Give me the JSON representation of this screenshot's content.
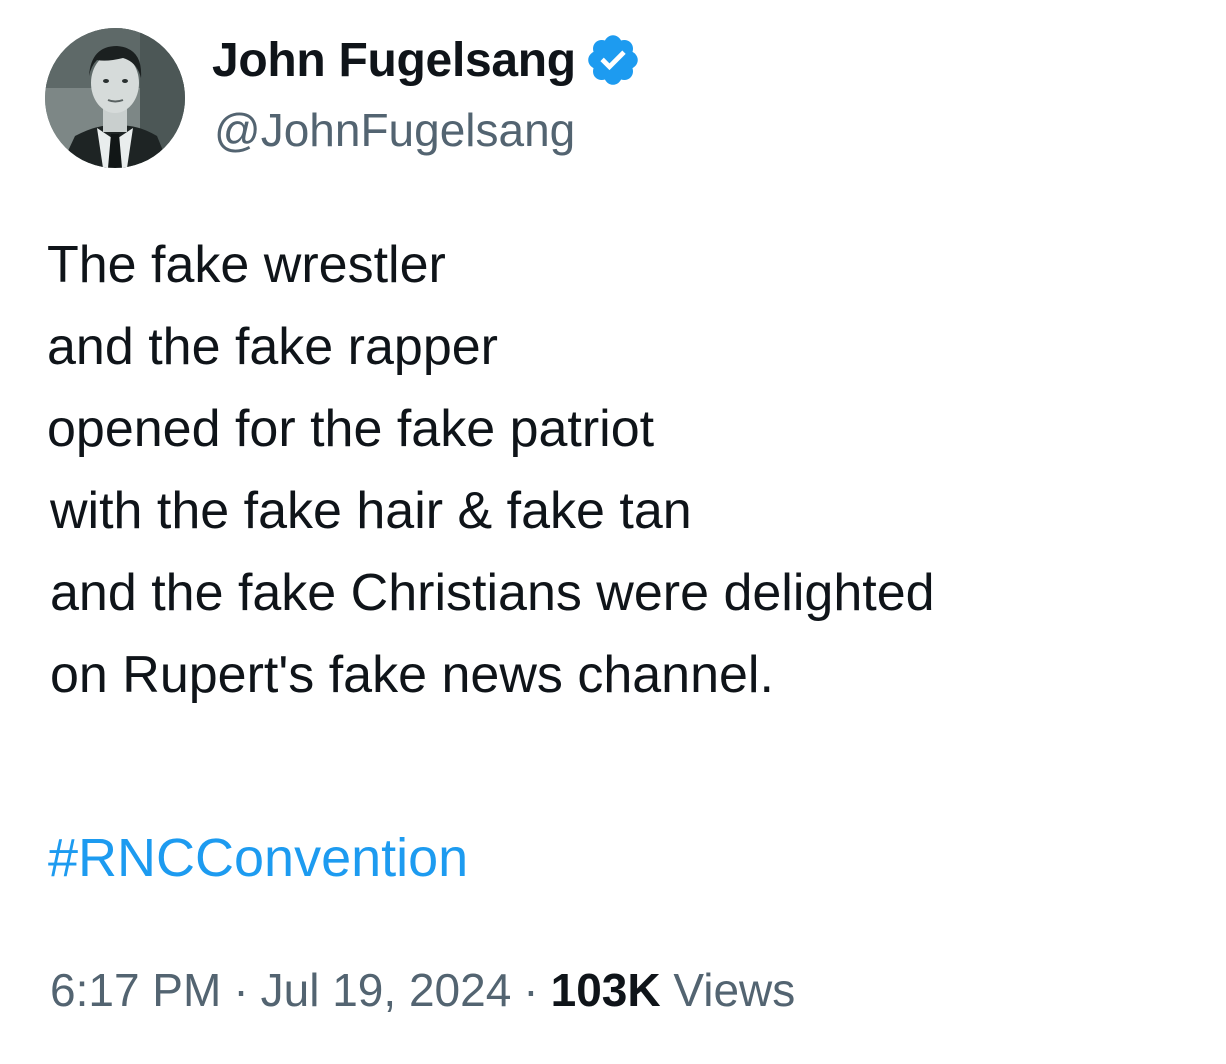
{
  "author": {
    "display_name": "John Fugelsang",
    "handle": "@JohnFugelsang",
    "verified": true,
    "badge_color": "#1d9bf0",
    "avatar_icon": "profile-photo-man-in-suit-and-tie"
  },
  "tweet": {
    "lines": [
      "The fake wrestler",
      "and the fake rapper",
      "opened for the fake patriot",
      "with the fake hair & fake tan",
      "and the fake Christians were delighted",
      "on Rupert's fake news channel."
    ],
    "hashtag": "#RNCConvention"
  },
  "meta": {
    "time": "6:17 PM",
    "separator": "·",
    "date": "Jul 19, 2024",
    "views_count": "103K",
    "views_label": "Views"
  },
  "colors": {
    "text": "#0f1419",
    "secondary": "#536471",
    "link": "#1d9bf0",
    "background": "#ffffff"
  }
}
